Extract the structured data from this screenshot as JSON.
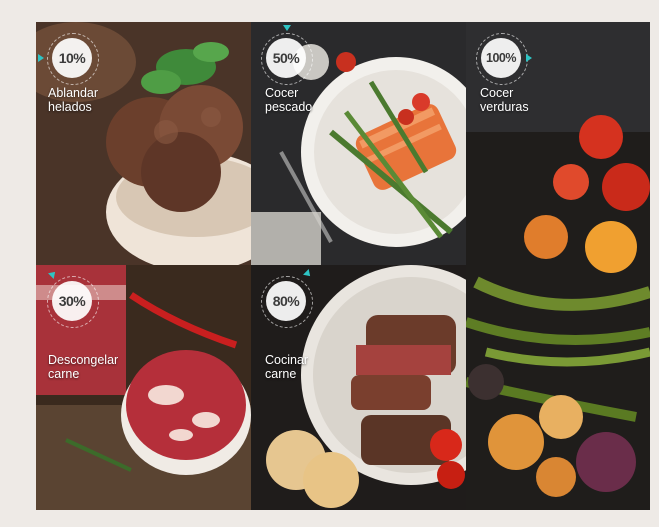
{
  "tiles": [
    {
      "percent": "10%",
      "line1": "Ablandar",
      "line2": "helados"
    },
    {
      "percent": "50%",
      "line1": "Cocer",
      "line2": "pescado"
    },
    {
      "percent": "100%",
      "line1": "Cocer",
      "line2": "verduras"
    },
    {
      "percent": "30%",
      "line1": "Descongelar",
      "line2": "carne"
    },
    {
      "percent": "80%",
      "line1": "Cocinar",
      "line2": "carne"
    }
  ],
  "colors": {
    "accent": "#2ec4c4",
    "badge_bg": "#ffffff",
    "label": "#ffffff"
  }
}
